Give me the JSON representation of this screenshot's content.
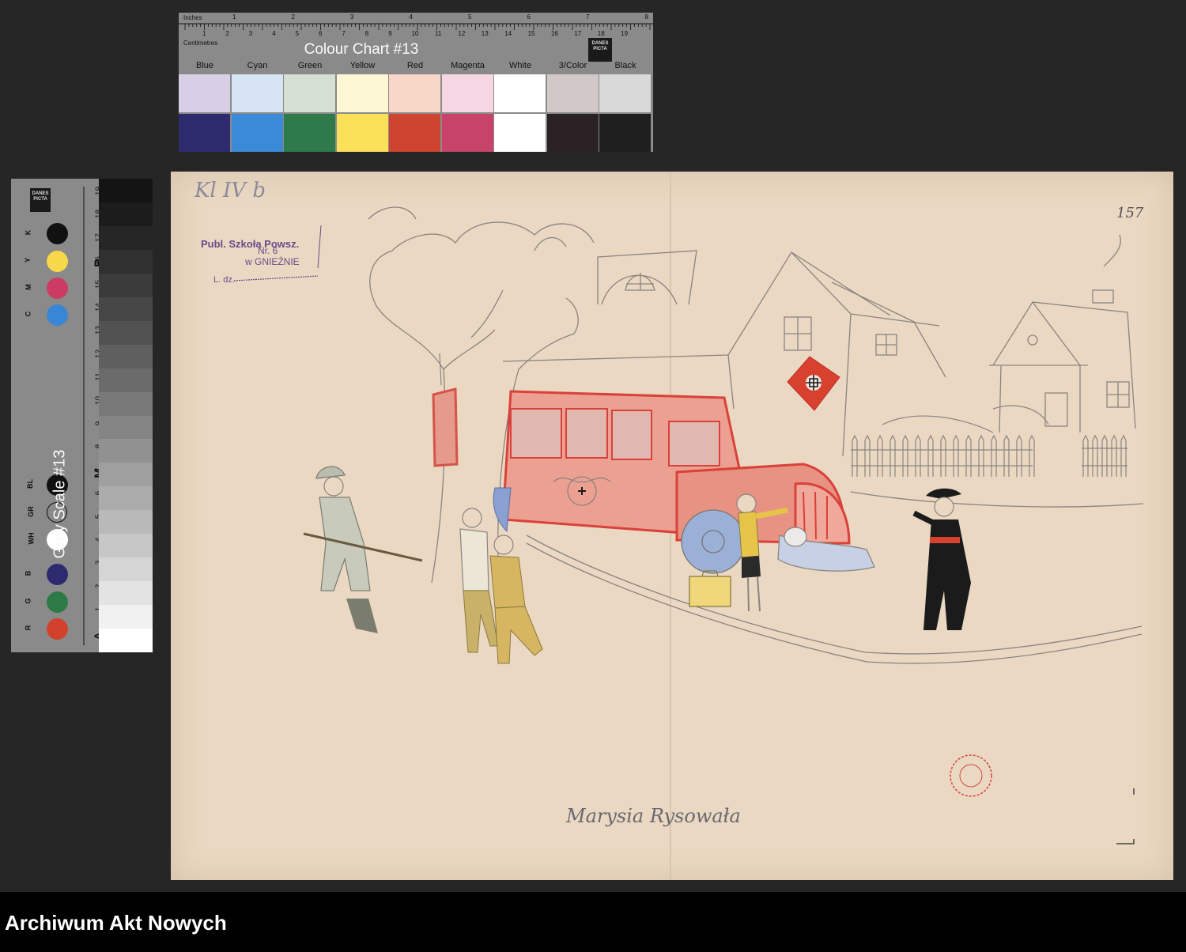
{
  "colour_chart": {
    "title": "Colour Chart #13",
    "ruler_inches_label": "Inches",
    "ruler_cm_label": "Centimetres",
    "inch_numbers": [
      "1",
      "2",
      "3",
      "4",
      "5",
      "6",
      "7",
      "8"
    ],
    "cm_numbers": [
      "1",
      "2",
      "3",
      "4",
      "5",
      "6",
      "7",
      "8",
      "9",
      "10",
      "11",
      "12",
      "13",
      "14",
      "15",
      "16",
      "17",
      "18",
      "19"
    ],
    "labels": [
      "Blue",
      "Cyan",
      "Green",
      "Yellow",
      "Red",
      "Magenta",
      "White",
      "3/Color",
      "Black"
    ],
    "light_colors": [
      "#d8cfe6",
      "#d6e4f5",
      "#d5e0d2",
      "#fdf7d6",
      "#f8d6c8",
      "#f6d6e2",
      "#ffffff",
      "#d2c8c8",
      "#d8d8d8"
    ],
    "dark_colors": [
      "#2e2a6e",
      "#3b8ad8",
      "#2e7a4a",
      "#fbe15a",
      "#cf4430",
      "#c8436a",
      "#ffffff",
      "#2b2226",
      "#1e1e1e"
    ],
    "logo": "DANES PICTA"
  },
  "grey_scale": {
    "title": "Grey Scale #13",
    "logo": "DANES PICTA",
    "swatches": [
      {
        "label": "K",
        "color": "#111111"
      },
      {
        "label": "Y",
        "color": "#f7d84a"
      },
      {
        "label": "M",
        "color": "#cc3c62"
      },
      {
        "label": "C",
        "color": "#3a86d6"
      },
      {
        "label": "BL",
        "color": "#111111"
      },
      {
        "label": "GR",
        "color": "#8a8a8a"
      },
      {
        "label": "WH",
        "color": "#ffffff"
      },
      {
        "label": "B",
        "color": "#2d2a70"
      },
      {
        "label": "G",
        "color": "#2e7a46"
      },
      {
        "label": "R",
        "color": "#d2412c"
      }
    ],
    "step_numbers": [
      "19",
      "18",
      "17",
      "16",
      "15",
      "14",
      "13",
      "12",
      "11",
      "10",
      "9",
      "8",
      "7",
      "6",
      "5",
      "4",
      "3",
      "2",
      "1"
    ],
    "letters": [
      "B",
      "M",
      "A"
    ]
  },
  "drawing": {
    "corner_note": "Kl IV b",
    "page_number": "157",
    "stamp_line1": "Publ. Szkoła Powsz.",
    "stamp_line2": "Nr. 6",
    "stamp_line3": "w GNIEŹNIE",
    "stamp_line4": "L. dz.",
    "signature": "Marysia Rysowała",
    "colors": {
      "paper": "#ead8c2",
      "pencil": "#8a8480",
      "bus_red": "#e06a5a",
      "flag_red": "#d9412f",
      "uniform_black": "#1b1b1b",
      "yellow_shirt": "#e6c44a",
      "soldier_grey": "#b9bcae",
      "stamp_ink": "#6b4a8a"
    }
  },
  "footer": {
    "title": "Archiwum Akt Nowych"
  }
}
